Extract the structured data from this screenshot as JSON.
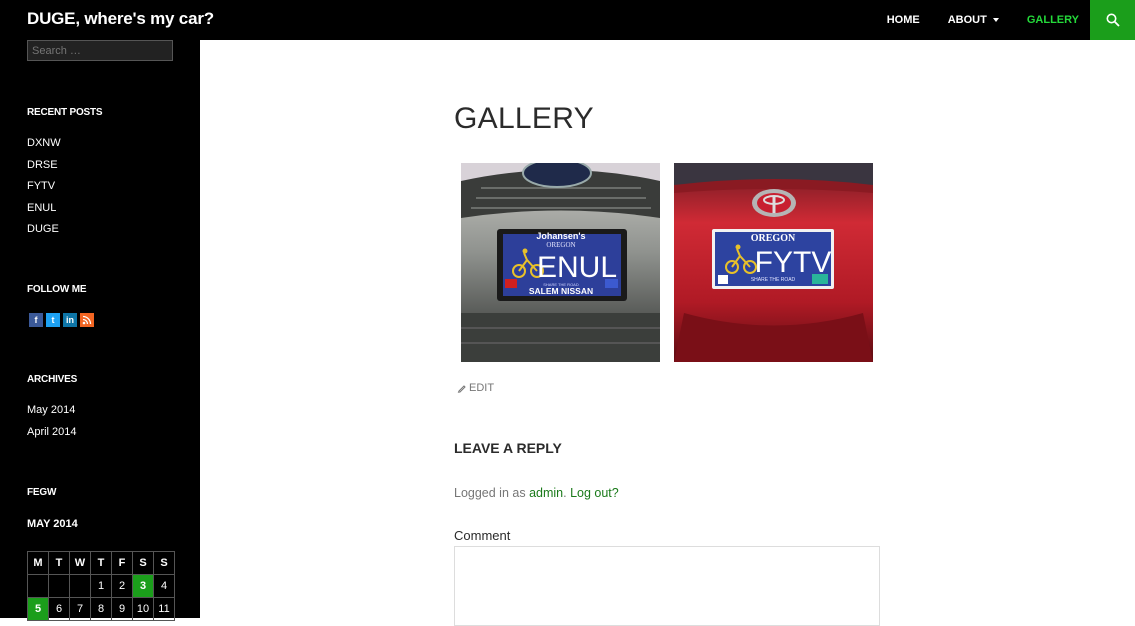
{
  "site": {
    "title": "DUGE, where's my car?"
  },
  "nav": {
    "home": "HOME",
    "about": "ABOUT",
    "gallery": "GALLERY"
  },
  "sidebar": {
    "search_placeholder": "Search …",
    "recent_posts_title": "RECENT POSTS",
    "recent_posts": [
      "DXNW",
      "DRSE",
      "FYTV",
      "ENUL",
      "DUGE"
    ],
    "follow_title": "FOLLOW ME",
    "social_icons": [
      "facebook-icon",
      "twitter-icon",
      "linkedin-icon",
      "rss-icon"
    ],
    "archives_title": "ARCHIVES",
    "archives": [
      "May 2014",
      "April 2014"
    ],
    "fegw_title": "FEGW",
    "calendar": {
      "month": "MAY 2014",
      "weekdays": [
        "M",
        "T",
        "W",
        "T",
        "F",
        "S",
        "S"
      ],
      "rows": [
        [
          "",
          "",
          "",
          "1",
          "2",
          "3",
          "4"
        ],
        [
          "5",
          "6",
          "7",
          "8",
          "9",
          "10",
          "11"
        ]
      ],
      "linked_days": [
        "3",
        "5"
      ]
    }
  },
  "page": {
    "title": "GALLERY",
    "images": [
      {
        "top_text": "Johansen's",
        "state": "OREGON",
        "plate": "ENUL",
        "slogan": "SHARE THE ROAD",
        "bottom_text": "SALEM NISSAN",
        "car": "silver Subaru"
      },
      {
        "top_text": "",
        "state": "OREGON",
        "plate": "FYTV",
        "slogan": "SHARE THE ROAD",
        "bottom_text": "",
        "car": "red Toyota"
      }
    ],
    "edit": "EDIT",
    "reply_title": "LEAVE A REPLY",
    "logged_prefix": "Logged in as ",
    "logged_user": "admin",
    "logout": "Log out?",
    "comment_label": "Comment"
  },
  "colors": {
    "accent": "#24d93a",
    "accent_dark": "#1b9e1b",
    "link": "#1a7a1a"
  }
}
